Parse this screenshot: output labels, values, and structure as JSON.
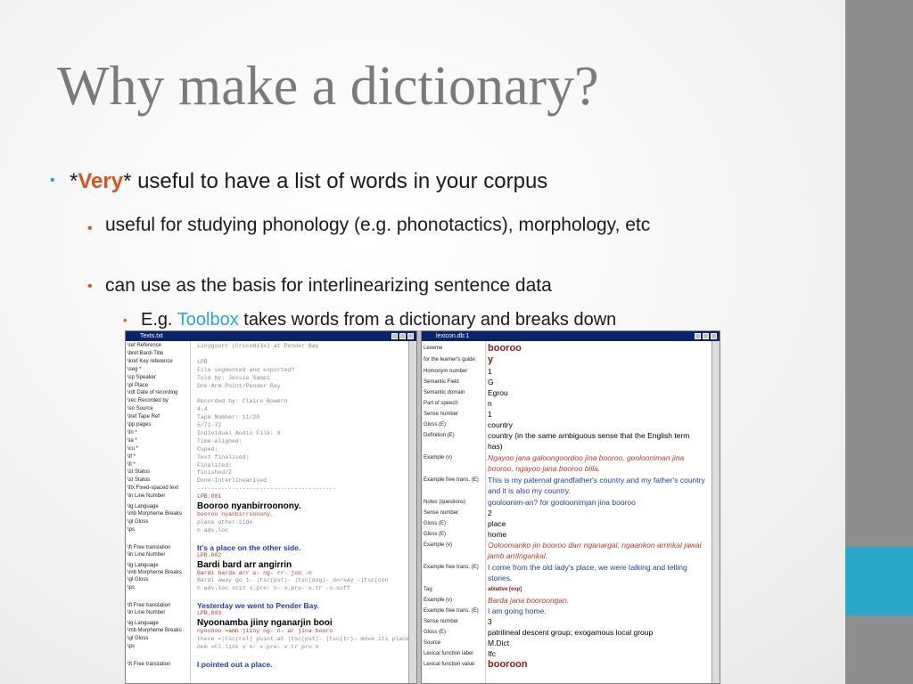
{
  "slide": {
    "title": "Why make a dictionary?",
    "b1": {
      "pre": "*",
      "emph": "Very",
      "post": "* useful to have a list of words in your corpus"
    },
    "b2": "useful for studying phonology (e.g. phonotactics), morphology, etc",
    "b3": "can use as the basis for interlinearizing sentence data",
    "b4": {
      "pre": "E.g. ",
      "link": "Toolbox",
      "post": " takes words from a dictionary and breaks down"
    },
    "bullet": "•"
  },
  "text_window": {
    "title": "Texts.txt",
    "rows": [
      {
        "m": "\\ref Reference",
        "v": "Linygoorr (Crocodile) at Pender Bay",
        "t": "g"
      },
      {
        "m": "\\bret Bardi Title",
        "v": "",
        "t": "g"
      },
      {
        "m": "\\kref Key reference",
        "v": "LPB",
        "t": "g"
      },
      {
        "m": "\\seg *",
        "v": "File segmented and exported?",
        "t": "g"
      },
      {
        "m": "\\sp Speaker",
        "v": "Told by: Jessie Sampi",
        "t": "g"
      },
      {
        "m": "\\pl Place",
        "v": "One Arm Point/Pender Bay",
        "t": "g"
      },
      {
        "m": "\\rdt Date of recording",
        "v": "",
        "t": "g"
      },
      {
        "m": "\\rec Recorded by",
        "v": "Recorded by: Claire Bowern",
        "t": "g"
      },
      {
        "m": "\\so Source",
        "v": "4.4",
        "t": "g"
      },
      {
        "m": "\\tref Tape Ref",
        "v": "Tape Number: 11/20",
        "t": "g"
      },
      {
        "m": "\\pp pages",
        "v": "5/71-72",
        "t": "g"
      },
      {
        "m": "\\fn *",
        "v": "Individual Audio File: X",
        "t": "g"
      },
      {
        "m": "\\ta *",
        "v": "Time-aligned:",
        "t": "g"
      },
      {
        "m": "\\cu *",
        "v": "Cuped:",
        "t": "g"
      },
      {
        "m": "\\tf *",
        "v": "Text finalised:",
        "t": "g"
      },
      {
        "m": "\\fi *",
        "v": "Finalized:",
        "t": "g"
      },
      {
        "m": "\\st Status",
        "v": "finished/Z",
        "t": "g"
      },
      {
        "m": "\\st Status",
        "v": "Done-Interlinearised",
        "t": "g"
      },
      {
        "m": "\\ftx Fixed-spaced text",
        "v": "----------------------------------------",
        "t": "g"
      },
      {
        "m": "\\ln Line Number",
        "v": "LPB.001",
        "t": "r"
      },
      {
        "m": "\\lg Language",
        "v": "Booroo nyanbirroonony.",
        "t": "b"
      },
      {
        "m": "\\mb Morpheme Breaks",
        "v": "booroo     nyanbirroonony.",
        "t": "r"
      },
      {
        "m": "\\gl Gloss",
        "v": "place      other.side",
        "t": "g"
      },
      {
        "m": "\\ps",
        "v": "n          adv.loc",
        "t": "g"
      },
      {
        "m": "",
        "v": "",
        "t": "g"
      },
      {
        "m": "\\ft Free translation",
        "v": "It's a place on the other side.",
        "t": "bl"
      },
      {
        "m": "\\ln Line Number",
        "v": "LPB.002",
        "t": "r"
      },
      {
        "m": "\\lg Language",
        "v": "Bardi bard arr angirrin",
        "t": "b"
      },
      {
        "m": "\\mb Morpheme Breaks",
        "v": "Bardi  barda arr  a-   ng-    rr-      joo   -n",
        "t": "r"
      },
      {
        "m": "\\gl Gloss",
        "v": "Bardi  away  go   1-  |tsc(pst)- |tsc(aug)- do/say -|tsc(con",
        "t": "g"
      },
      {
        "m": "\\ps",
        "v": "n      adv.loc vcit v.pre- n-     v.pre-   v.tr   -v.suff",
        "t": "g"
      },
      {
        "m": "",
        "v": "",
        "t": "g"
      },
      {
        "m": "\\ft Free translation",
        "v": "Yesterday we went to Pender Bay.",
        "t": "bl"
      },
      {
        "m": "\\ln Line Number",
        "v": "LPB.003",
        "t": "r"
      },
      {
        "m": "\\lg Language",
        "v": "Nyoonamba  jiiny  nganarjin          booi",
        "t": "b"
      },
      {
        "m": "\\mb Morpheme Breaks",
        "v": "nyoonoo =amb  jiiny   ng-     n-     ar   jina  booro",
        "t": "r"
      },
      {
        "m": "\\gl Gloss",
        "v": "there   =|tsc(rel) point.at |tsc(pst)- |tsc(tr)- move its place",
        "t": "g"
      },
      {
        "m": "\\ps",
        "v": "dem     =Cl.link  v    n-     v.pre-  v.tr  pro  n",
        "t": "g"
      },
      {
        "m": "",
        "v": "",
        "t": "g"
      },
      {
        "m": "\\ft Free translation",
        "v": "I pointed out a place.",
        "t": "bl"
      }
    ]
  },
  "lex_window": {
    "title": "lexicon.db:1",
    "rows": [
      {
        "m": "Lexeme",
        "v": "booroo",
        "t": "b"
      },
      {
        "m": "for the learner's guide",
        "v": "y",
        "t": "b"
      },
      {
        "m": "Homonym number",
        "v": "1",
        "t": "n"
      },
      {
        "m": "Semantic Field",
        "v": "G",
        "t": "n"
      },
      {
        "m": "Semantic domain",
        "v": "Egrou",
        "t": "n"
      },
      {
        "m": "Part of speech",
        "v": "n",
        "t": "n"
      },
      {
        "m": "Sense number",
        "v": "1",
        "t": "n"
      },
      {
        "m": "Gloss (E)",
        "v": "country",
        "t": "n"
      },
      {
        "m": "Definition (E)",
        "v": "country (in the same ambiguous sense that the English term has)",
        "t": "n2"
      },
      {
        "m": "Example (v)",
        "v": "Ngayoo jana galoongoordoo jina booroo, goolooniman jina booroo, ngayoo jana booroo biila.",
        "t": "r2"
      },
      {
        "m": "Example free trans. (E)",
        "v": "This is my paternal grandfather's country and my father's country and it is also my country.",
        "t": "bl2"
      },
      {
        "m": "Notes (questions)",
        "v": "gooloonim-an? for gooloonimjan jina booroo",
        "t": "bl"
      },
      {
        "m": "Sense number",
        "v": "2",
        "t": "n"
      },
      {
        "m": "Gloss (E)",
        "v": "place",
        "t": "n"
      },
      {
        "m": "Gloss (E)",
        "v": "home",
        "t": "n"
      },
      {
        "m": "Example (v)",
        "v": "Ooloomanko jin booroo darr nganargal, ngaankon arrinkal jawal jamb arrilngankal.",
        "t": "r2"
      },
      {
        "m": "Example free trans. (E)",
        "v": "I come from the old lady's place, we were talking and telling stories.",
        "t": "bl2"
      },
      {
        "m": "Tag",
        "v": "ablative [exp]",
        "t": "tag"
      },
      {
        "m": "Example (v)",
        "v": "Barda jana booroongan.",
        "t": "r"
      },
      {
        "m": "Example free trans. (E)",
        "v": "I am going home.",
        "t": "bl"
      },
      {
        "m": "Sense number",
        "v": "3",
        "t": "n"
      },
      {
        "m": "Gloss (E)",
        "v": "patrilineal descent group; exogamous local group",
        "t": "n"
      },
      {
        "m": "Source",
        "v": "M.Dict",
        "t": "n"
      },
      {
        "m": "Lexical function label",
        "v": "Ifc",
        "t": "n"
      },
      {
        "m": "Lexical function value",
        "v": "booroon",
        "t": "b"
      }
    ]
  }
}
